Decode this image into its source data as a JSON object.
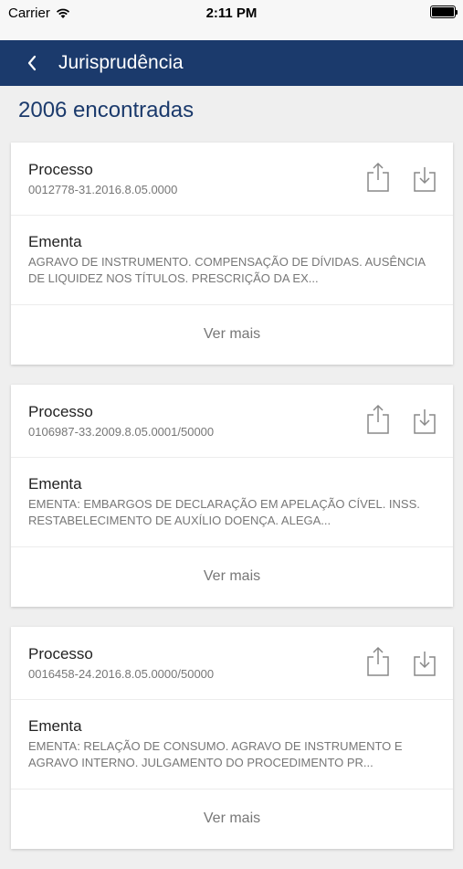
{
  "status_bar": {
    "carrier": "Carrier",
    "time": "2:11 PM"
  },
  "nav": {
    "title": "Jurisprudência"
  },
  "results": {
    "count_text": "2006 encontradas"
  },
  "cards": [
    {
      "processo_label": "Processo",
      "processo_value": "0012778-31.2016.8.05.0000",
      "ementa_label": "Ementa",
      "ementa_text": "AGRAVO DE INSTRUMENTO. COMPENSAÇÃO DE DÍVIDAS. AUSÊNCIA DE LIQUIDEZ NOS TÍTULOS. PRESCRIÇÃO DA EX...",
      "more_label": "Ver mais"
    },
    {
      "processo_label": "Processo",
      "processo_value": "0106987-33.2009.8.05.0001/50000",
      "ementa_label": "Ementa",
      "ementa_text": "EMENTA: EMBARGOS DE DECLARAÇÃO EM APELAÇÃO CÍVEL. INSS. RESTABELECIMENTO DE AUXÍLIO DOENÇA. ALEGA...",
      "more_label": "Ver mais"
    },
    {
      "processo_label": "Processo",
      "processo_value": "0016458-24.2016.8.05.0000/50000",
      "ementa_label": "Ementa",
      "ementa_text": "EMENTA: RELAÇÃO DE CONSUMO. AGRAVO DE INSTRUMENTO E AGRAVO INTERNO. JULGAMENTO DO PROCEDIMENTO PR...",
      "more_label": "Ver mais"
    }
  ],
  "icons": {
    "back": "chevron-left-icon",
    "share": "share-icon",
    "download": "download-icon",
    "wifi": "wifi-icon",
    "battery": "battery-icon"
  },
  "colors": {
    "nav_background": "#1b3a6c",
    "title_accent": "#1b3a6c",
    "background": "#efefef"
  }
}
